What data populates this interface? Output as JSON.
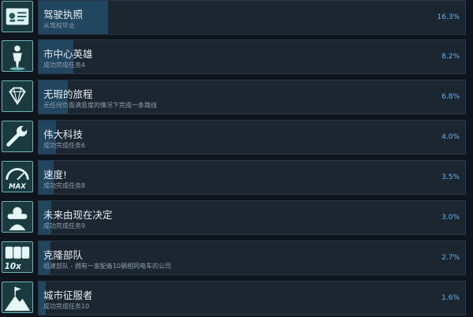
{
  "achievements": [
    {
      "name": "驾驶执照",
      "desc": "从驾校毕业",
      "percent_text": "16.3%",
      "percent": 16.3,
      "icon": "license-card-icon"
    },
    {
      "name": "市中心英雄",
      "desc": "成功完成任务4",
      "percent_text": "8.2%",
      "percent": 8.2,
      "icon": "hero-person-icon"
    },
    {
      "name": "无瑕的旅程",
      "desc": "无任何负面满意度的情况下完成一条路线",
      "percent_text": "6.8%",
      "percent": 6.8,
      "icon": "diamond-icon"
    },
    {
      "name": "伟大科技",
      "desc": "成功完成任务6",
      "percent_text": "4.0%",
      "percent": 4.0,
      "icon": "wrench-icon"
    },
    {
      "name": "速度!",
      "desc": "成功完成任务8",
      "percent_text": "3.5%",
      "percent": 3.5,
      "icon": "speedometer-max-icon",
      "icon_text": "MAX"
    },
    {
      "name": "未来由现在决定",
      "desc": "成功完成任务9",
      "percent_text": "3.0%",
      "percent": 3.0,
      "icon": "vr-headset-icon"
    },
    {
      "name": "克隆部队",
      "desc": "组建部队 - 拥有一家配备10辆相同电车的公司",
      "percent_text": "2.7%",
      "percent": 2.7,
      "icon": "trams-10x-icon",
      "icon_text": "10x"
    },
    {
      "name": "城市征服者",
      "desc": "成功完成任务10",
      "percent_text": "1.6%",
      "percent": 1.6,
      "icon": "mountain-flag-icon"
    }
  ]
}
